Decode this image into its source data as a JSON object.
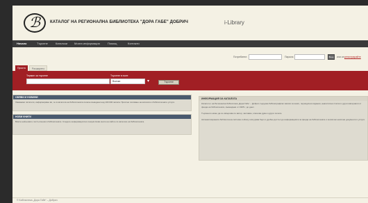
{
  "header": {
    "logo_glyph": "ℬ",
    "title": "КАТАЛОГ НА РЕГИОНАЛНА БИБЛИОТЕКА \"ДОРА ГАБЕ\" ДОБРИЧ",
    "brand": "i-Library"
  },
  "nav": {
    "items": [
      {
        "label": "Начало"
      },
      {
        "label": "Търсене"
      },
      {
        "label": "Каталози"
      },
      {
        "label": "Моята информация"
      },
      {
        "label": "Помощ"
      },
      {
        "label": "Контакти"
      }
    ]
  },
  "login": {
    "user_label": "Потребител:",
    "pass_label": "Парола:",
    "button": "Вход",
    "link_prefix": "или се",
    "link_text": "регистрирайте"
  },
  "tabs": [
    {
      "label": "Проста"
    },
    {
      "label": "Разширено"
    }
  ],
  "search": {
    "term_label": "Термин за търсене",
    "field_label": "Търсене в поле",
    "field_value": "Всички",
    "button": "Търсене"
  },
  "panels": {
    "news": {
      "title": "ОБЯВИ И НОВИНИ",
      "body": "Уважаеми читатели, информираме ви, че в каталога на библиотеката са вече въведени над 100 000 записа. Приятно ползване на каталога и библиотечните услуги."
    },
    "new_books": {
      "title": "НОВИ КНИГИ",
      "body": "Вижте най-новите постъпления в библиотеката. Следете информацията в секция Нови книги на сайта и в каталога на библиотеката."
    },
    "about": {
      "title": "ИНФОРМАЦИЯ ЗА КАТАЛОГА",
      "p1": "Каталогът на Регионална библиотека „Дора Габе“ – Добрич съдържа библиографски записи за книги, периодични издания, аналитични статии и други материали от фонда на библиотеката, въвеждани от 1995 г. до днес.",
      "p2": "Търсенето може да се извършва по автор, заглавие, ключова дума и други полета.",
      "p3": "Автоматизираната библиотечна система i-Library осигурява бърз и удобен достъп до информацията за фонда на библиотеката и за всички налични документи и услуги."
    }
  },
  "footer": {
    "text": "© Библиотека „Дора Габе“ – Добрич"
  }
}
